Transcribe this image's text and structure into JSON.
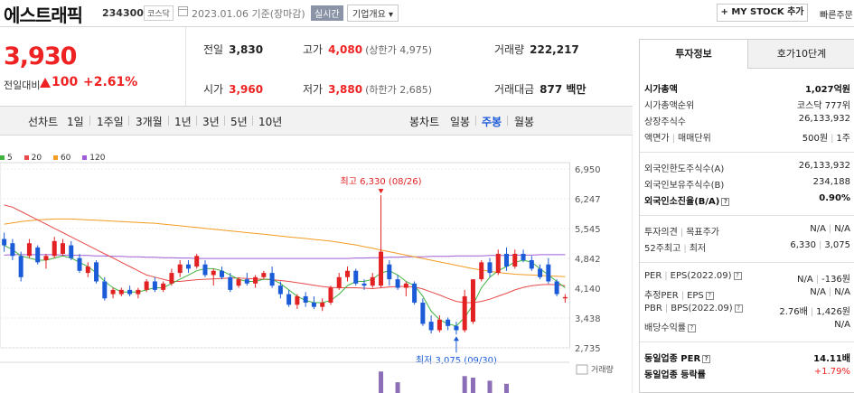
{
  "header": {
    "name": "에스트래픽",
    "code": "234300",
    "market": "코스닥",
    "date": "2023.01.06 기준(장마감)",
    "realtime": "실시간",
    "company_info": "기업개요 ▾",
    "mystock": "+ MY STOCK 추가",
    "quick_order": "빠른주문"
  },
  "price": {
    "current": "3,930",
    "change_label": "전일대비",
    "change_value": "100",
    "change_pct": "+2.61%"
  },
  "quotes": {
    "prev_close_label": "전일",
    "prev_close": "3,830",
    "high_label": "고가",
    "high": "4,080",
    "upper_limit": "(상한가 4,975)",
    "volume_label": "거래량",
    "volume": "222,217",
    "open_label": "시가",
    "open": "3,960",
    "low_label": "저가",
    "low": "3,880",
    "lower_limit": "(하한가 2,685)",
    "amount_label": "거래대금",
    "amount": "877 백만"
  },
  "period_bar": {
    "line_chart": "선차트",
    "periods": [
      "1일",
      "1주일",
      "3개월",
      "1년",
      "3년",
      "5년",
      "10년"
    ],
    "candle_chart": "봉차트",
    "candles": [
      "일봉",
      "주봉",
      "월봉"
    ],
    "selected_candle": "주봉"
  },
  "chart_data": {
    "type": "candlestick",
    "legend": [
      {
        "name": "5",
        "color": "#3eb33e"
      },
      {
        "name": "20",
        "color": "#e84a4a"
      },
      {
        "name": "60",
        "color": "#f39c22"
      },
      {
        "name": "120",
        "color": "#a05cd6"
      }
    ],
    "y_ticks": [
      "6,950",
      "6,247",
      "5,545",
      "4,842",
      "4,140",
      "3,438",
      "2,735"
    ],
    "ylim": [
      2735,
      6950
    ],
    "high_label": "최고 6,330 (08/26)",
    "low_label": "최저 3,075 (09/30)",
    "volume_label": "거래량",
    "up_color": "#e22222",
    "down_color": "#1b5bd8",
    "candles": [
      {
        "o": 5300,
        "h": 5450,
        "l": 5000,
        "c": 5150
      },
      {
        "o": 5200,
        "h": 5300,
        "l": 4800,
        "c": 4900
      },
      {
        "o": 4900,
        "h": 5000,
        "l": 4300,
        "c": 4400
      },
      {
        "o": 4900,
        "h": 5300,
        "l": 4850,
        "c": 5200
      },
      {
        "o": 5100,
        "h": 5150,
        "l": 4700,
        "c": 4750
      },
      {
        "o": 4800,
        "h": 4950,
        "l": 4600,
        "c": 4900
      },
      {
        "o": 4900,
        "h": 5350,
        "l": 4850,
        "c": 5250
      },
      {
        "o": 4950,
        "h": 5300,
        "l": 4900,
        "c": 5200
      },
      {
        "o": 5150,
        "h": 5250,
        "l": 4800,
        "c": 4850
      },
      {
        "o": 4850,
        "h": 4950,
        "l": 4500,
        "c": 4550
      },
      {
        "o": 4500,
        "h": 4750,
        "l": 4400,
        "c": 4650
      },
      {
        "o": 4750,
        "h": 4800,
        "l": 4250,
        "c": 4300
      },
      {
        "o": 4300,
        "h": 4400,
        "l": 3850,
        "c": 3900
      },
      {
        "o": 4000,
        "h": 4150,
        "l": 3900,
        "c": 4100
      },
      {
        "o": 4000,
        "h": 4150,
        "l": 3950,
        "c": 4100
      },
      {
        "o": 4100,
        "h": 4200,
        "l": 3950,
        "c": 4000
      },
      {
        "o": 4000,
        "h": 4150,
        "l": 3900,
        "c": 4100
      },
      {
        "o": 4100,
        "h": 4350,
        "l": 4050,
        "c": 4300
      },
      {
        "o": 4300,
        "h": 4400,
        "l": 4050,
        "c": 4100
      },
      {
        "o": 4100,
        "h": 4300,
        "l": 4050,
        "c": 4250
      },
      {
        "o": 4250,
        "h": 4600,
        "l": 4200,
        "c": 4500
      },
      {
        "o": 4500,
        "h": 4800,
        "l": 4400,
        "c": 4700
      },
      {
        "o": 4700,
        "h": 4800,
        "l": 4500,
        "c": 4600
      },
      {
        "o": 4650,
        "h": 4950,
        "l": 4600,
        "c": 4900
      },
      {
        "o": 4700,
        "h": 4800,
        "l": 4400,
        "c": 4450
      },
      {
        "o": 4450,
        "h": 4600,
        "l": 4200,
        "c": 4550
      },
      {
        "o": 4550,
        "h": 4650,
        "l": 4350,
        "c": 4400
      },
      {
        "o": 4400,
        "h": 4500,
        "l": 4050,
        "c": 4100
      },
      {
        "o": 4200,
        "h": 4400,
        "l": 4150,
        "c": 4350
      },
      {
        "o": 4350,
        "h": 4500,
        "l": 4200,
        "c": 4250
      },
      {
        "o": 4250,
        "h": 4450,
        "l": 4150,
        "c": 4400
      },
      {
        "o": 4400,
        "h": 4550,
        "l": 4350,
        "c": 4500
      },
      {
        "o": 4500,
        "h": 4650,
        "l": 4150,
        "c": 4200
      },
      {
        "o": 4200,
        "h": 4300,
        "l": 3900,
        "c": 4000
      },
      {
        "o": 4000,
        "h": 4100,
        "l": 3700,
        "c": 3750
      },
      {
        "o": 3750,
        "h": 4000,
        "l": 3650,
        "c": 3950
      },
      {
        "o": 3950,
        "h": 4050,
        "l": 3700,
        "c": 3800
      },
      {
        "o": 3800,
        "h": 3950,
        "l": 3650,
        "c": 3700
      },
      {
        "o": 3700,
        "h": 3900,
        "l": 3600,
        "c": 3800
      },
      {
        "o": 3800,
        "h": 4200,
        "l": 3750,
        "c": 4150
      },
      {
        "o": 4150,
        "h": 4500,
        "l": 4100,
        "c": 4400
      },
      {
        "o": 4400,
        "h": 4650,
        "l": 4300,
        "c": 4550
      },
      {
        "o": 4550,
        "h": 4600,
        "l": 4200,
        "c": 4250
      },
      {
        "o": 4250,
        "h": 4350,
        "l": 4100,
        "c": 4200
      },
      {
        "o": 4200,
        "h": 4500,
        "l": 4150,
        "c": 4400
      },
      {
        "o": 4200,
        "h": 6330,
        "l": 4150,
        "c": 5000
      },
      {
        "o": 4700,
        "h": 4800,
        "l": 4200,
        "c": 4350
      },
      {
        "o": 4350,
        "h": 4450,
        "l": 4100,
        "c": 4150
      },
      {
        "o": 4150,
        "h": 4300,
        "l": 3950,
        "c": 4250
      },
      {
        "o": 4250,
        "h": 4300,
        "l": 3750,
        "c": 3800
      },
      {
        "o": 3800,
        "h": 3900,
        "l": 3250,
        "c": 3300
      },
      {
        "o": 3350,
        "h": 3500,
        "l": 3075,
        "c": 3150
      },
      {
        "o": 3150,
        "h": 3500,
        "l": 3100,
        "c": 3400
      },
      {
        "o": 3400,
        "h": 3450,
        "l": 3150,
        "c": 3250
      },
      {
        "o": 3250,
        "h": 3350,
        "l": 3050,
        "c": 3150
      },
      {
        "o": 3150,
        "h": 4100,
        "l": 3100,
        "c": 3950
      },
      {
        "o": 3350,
        "h": 4150,
        "l": 3300,
        "c": 4350
      },
      {
        "o": 4350,
        "h": 4800,
        "l": 4300,
        "c": 4750
      },
      {
        "o": 4750,
        "h": 4850,
        "l": 4400,
        "c": 4500
      },
      {
        "o": 4500,
        "h": 5050,
        "l": 4450,
        "c": 4950
      },
      {
        "o": 4950,
        "h": 5100,
        "l": 4550,
        "c": 4650
      },
      {
        "o": 4650,
        "h": 5050,
        "l": 4600,
        "c": 4950
      },
      {
        "o": 4950,
        "h": 5050,
        "l": 4750,
        "c": 4800
      },
      {
        "o": 4800,
        "h": 4900,
        "l": 4550,
        "c": 4600
      },
      {
        "o": 4600,
        "h": 4700,
        "l": 4350,
        "c": 4400
      },
      {
        "o": 4700,
        "h": 4850,
        "l": 4250,
        "c": 4300
      },
      {
        "o": 4300,
        "h": 4350,
        "l": 3950,
        "c": 4000
      },
      {
        "o": 3900,
        "h": 4000,
        "l": 3800,
        "c": 3930
      }
    ],
    "ma5": [
      5150,
      5050,
      4900,
      4850,
      4800,
      4800,
      4850,
      4900,
      4850,
      4750,
      4650,
      4500,
      4300,
      4150,
      4050,
      4050,
      4050,
      4100,
      4150,
      4150,
      4250,
      4350,
      4450,
      4550,
      4600,
      4600,
      4550,
      4450,
      4350,
      4300,
      4300,
      4350,
      4350,
      4250,
      4100,
      3950,
      3850,
      3800,
      3800,
      3850,
      4000,
      4200,
      4300,
      4300,
      4350,
      4500,
      4550,
      4450,
      4300,
      4200,
      3950,
      3600,
      3400,
      3300,
      3250,
      3450,
      3750,
      4150,
      4400,
      4550,
      4650,
      4750,
      4800,
      4750,
      4600,
      4450,
      4300,
      4150
    ],
    "ma20": [
      6100,
      6050,
      5950,
      5850,
      5750,
      5650,
      5550,
      5450,
      5350,
      5250,
      5150,
      5050,
      4950,
      4850,
      4750,
      4650,
      4550,
      4450,
      4400,
      4350,
      4300,
      4300,
      4320,
      4340,
      4350,
      4360,
      4370,
      4380,
      4380,
      4370,
      4360,
      4350,
      4340,
      4320,
      4300,
      4270,
      4240,
      4210,
      4180,
      4160,
      4150,
      4150,
      4150,
      4140,
      4130,
      4150,
      4170,
      4180,
      4180,
      4170,
      4120,
      4050,
      3980,
      3900,
      3830,
      3800,
      3800,
      3830,
      3880,
      3950,
      4020,
      4100,
      4160,
      4200,
      4220,
      4230,
      4220,
      4200
    ],
    "ma60": [
      5650,
      5680,
      5710,
      5730,
      5750,
      5760,
      5770,
      5770,
      5770,
      5760,
      5750,
      5740,
      5730,
      5720,
      5710,
      5700,
      5690,
      5680,
      5670,
      5650,
      5630,
      5610,
      5590,
      5570,
      5550,
      5530,
      5510,
      5490,
      5470,
      5450,
      5430,
      5410,
      5390,
      5370,
      5350,
      5330,
      5310,
      5290,
      5270,
      5250,
      5220,
      5190,
      5160,
      5120,
      5080,
      5040,
      5000,
      4960,
      4920,
      4880,
      4840,
      4800,
      4760,
      4720,
      4680,
      4640,
      4600,
      4570,
      4540,
      4510,
      4490,
      4470,
      4460,
      4450,
      4440,
      4430,
      4420,
      4410
    ],
    "ma120": [
      4920,
      4930,
      4930,
      4930,
      4930,
      4930,
      4930,
      4920,
      4920,
      4910,
      4910,
      4900,
      4900,
      4890,
      4890,
      4880,
      4880,
      4870,
      4870,
      4860,
      4860,
      4850,
      4850,
      4840,
      4840,
      4840,
      4840,
      4840,
      4840,
      4840,
      4840,
      4840,
      4840,
      4840,
      4840,
      4840,
      4840,
      4840,
      4840,
      4840,
      4840,
      4840,
      4850,
      4850,
      4860,
      4860,
      4870,
      4870,
      4880,
      4880,
      4880,
      4890,
      4890,
      4890,
      4900,
      4900,
      4900,
      4900,
      4910,
      4910,
      4910,
      4920,
      4920,
      4920,
      4930,
      4930,
      4930,
      4930
    ],
    "volumes": [
      {
        "i": 45,
        "v": 0.7,
        "dir": "up"
      },
      {
        "i": 47,
        "v": 0.35,
        "dir": "down"
      },
      {
        "i": 55,
        "v": 0.55,
        "dir": "up"
      },
      {
        "i": 56,
        "v": 0.5,
        "dir": "up"
      },
      {
        "i": 58,
        "v": 0.4,
        "dir": "down"
      },
      {
        "i": 60,
        "v": 0.3,
        "dir": "up"
      }
    ]
  },
  "panel": {
    "tab_invest": "투자정보",
    "tab_orderbook": "호가10단계",
    "mcap_label": "시가총액",
    "mcap": "1,027억원",
    "mcap_rank_label": "시가총액순위",
    "mcap_rank": "코스닥 777위",
    "shares_label": "상장주식수",
    "shares": "26,133,932",
    "par_label": "액면가",
    "unit_label": "매매단위",
    "par": "500원",
    "unit": "1주",
    "foreign_limit_label": "외국인한도주식수(A)",
    "foreign_limit": "26,133,932",
    "foreign_hold_label": "외국인보유주식수(B)",
    "foreign_hold": "234,188",
    "foreign_ratio_label": "외국인소진율(B/A)",
    "foreign_ratio": "0.90%",
    "opinion_label": "투자의견",
    "target_label": "목표주가",
    "opinion": "N/A",
    "target": "N/A",
    "w52_high_label": "52주최고",
    "w52_low_label": "최저",
    "w52_high": "6,330",
    "w52_low": "3,075",
    "per_label": "PER",
    "eps_label": "EPS(2022.09)",
    "per": "N/A",
    "eps": "-136원",
    "est_per_label": "추정PER",
    "est_eps_label": "EPS",
    "est_per": "N/A",
    "est_eps": "N/A",
    "pbr_label": "PBR",
    "bps_label": "BPS(2022.09)",
    "pbr": "2.76배",
    "bps": "1,426원",
    "div_label": "배당수익률",
    "div": "N/A",
    "ind_per_label": "동일업종 PER",
    "ind_per": "14.11배",
    "ind_rate_label": "동일업종 등락률",
    "ind_rate": "+1.79%"
  }
}
